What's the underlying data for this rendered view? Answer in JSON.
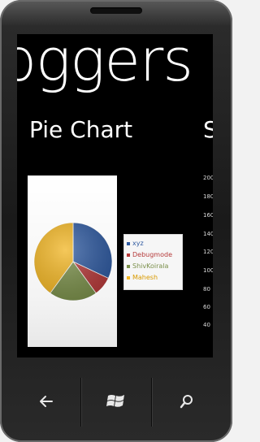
{
  "panorama": {
    "title": "oggers"
  },
  "sections": [
    {
      "header": "Pie Chart"
    },
    {
      "header": "S"
    }
  ],
  "chart_data": [
    {
      "type": "pie",
      "series": [
        {
          "name": "xyz",
          "value": 32,
          "color": "#2f5aa0"
        },
        {
          "name": "Debugmode",
          "value": 8,
          "color": "#b53a3a"
        },
        {
          "name": "ShivKoirala",
          "value": 20,
          "color": "#7a8f4a"
        },
        {
          "name": "Mahesh",
          "value": 40,
          "color": "#f2b624"
        }
      ],
      "legend_position": "right"
    },
    {
      "type": "bar",
      "yticks": [
        "200",
        "180",
        "160",
        "140",
        "120",
        "100",
        "80",
        "60",
        "40"
      ]
    }
  ],
  "nav": {
    "back_icon": "back-arrow-icon",
    "start_icon": "windows-logo-icon",
    "search_icon": "search-icon"
  }
}
